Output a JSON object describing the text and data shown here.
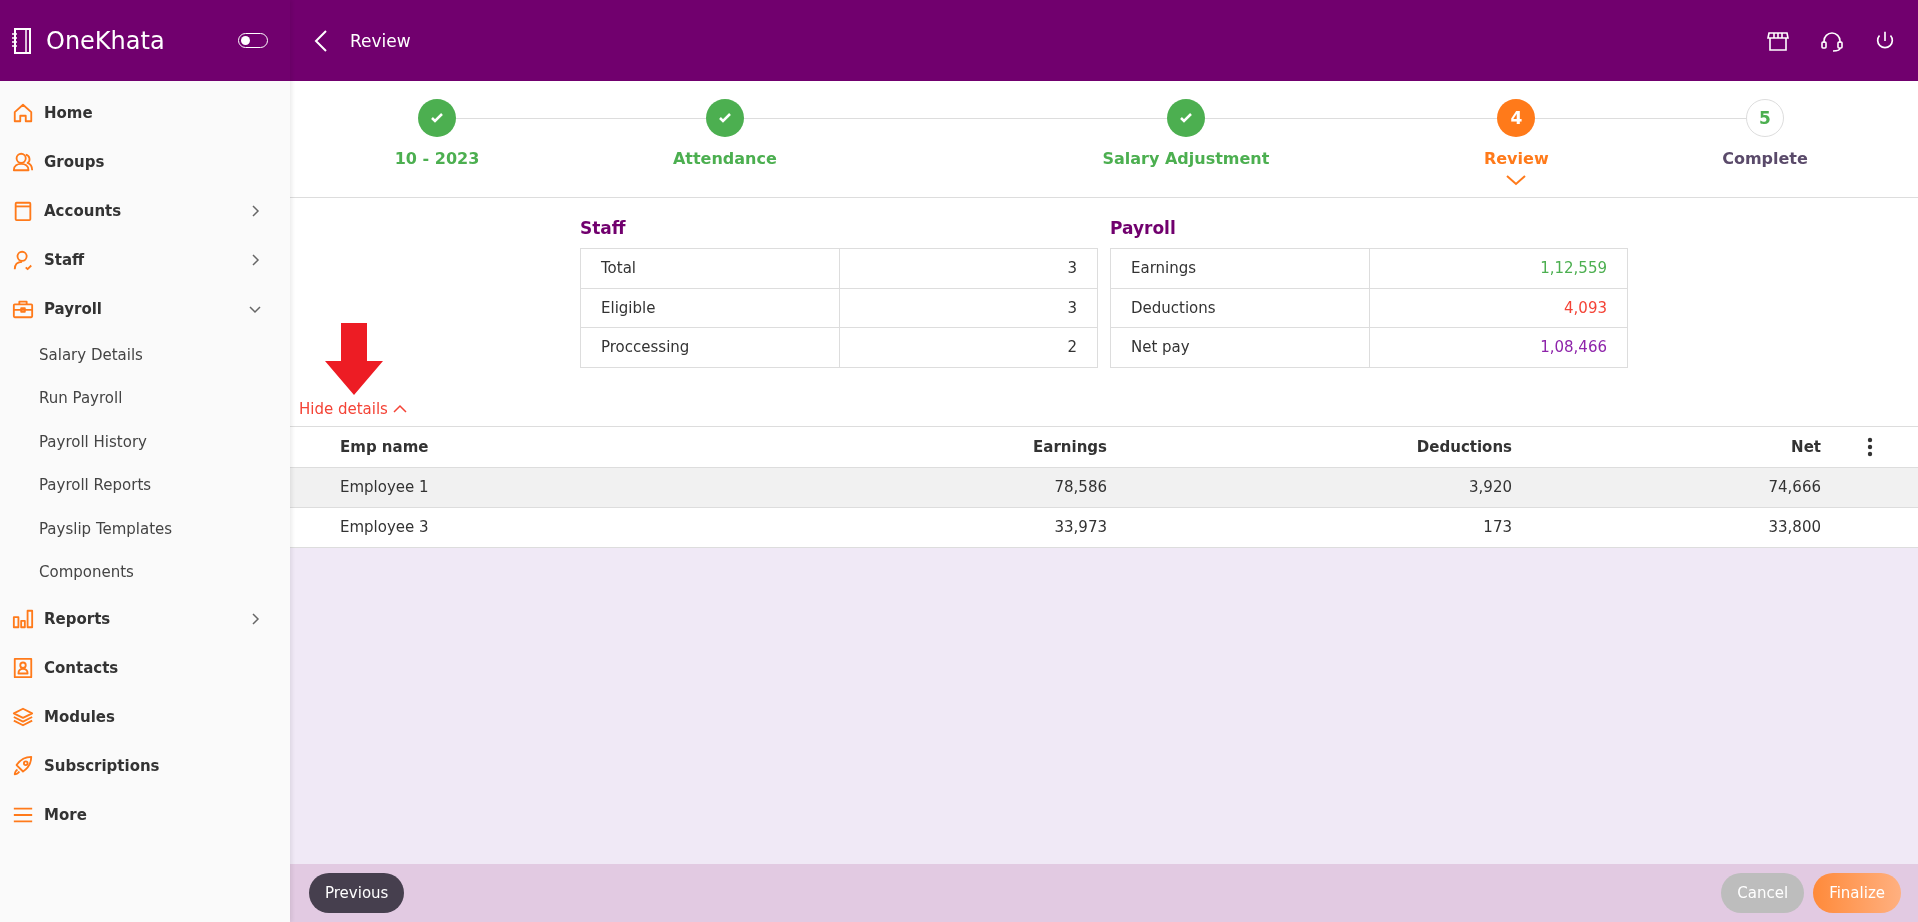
{
  "app": {
    "name": "OneKhata",
    "toggle_on": false
  },
  "sidebar": {
    "items": [
      {
        "label": "Home"
      },
      {
        "label": "Groups"
      },
      {
        "label": "Accounts",
        "expanded": false
      },
      {
        "label": "Staff",
        "expanded": false
      },
      {
        "label": "Payroll",
        "expanded": true,
        "children": [
          {
            "label": "Salary Details"
          },
          {
            "label": "Run Payroll"
          },
          {
            "label": "Payroll History"
          },
          {
            "label": "Payroll Reports"
          },
          {
            "label": "Payslip Templates"
          },
          {
            "label": "Components"
          }
        ]
      },
      {
        "label": "Reports",
        "expanded": false
      },
      {
        "label": "Contacts"
      },
      {
        "label": "Modules"
      },
      {
        "label": "Subscriptions"
      },
      {
        "label": "More"
      }
    ]
  },
  "header": {
    "title": "Review"
  },
  "steps": [
    {
      "label": "10 - 2023",
      "completed": true,
      "selected": false
    },
    {
      "label": "Attendance",
      "completed": true,
      "selected": false
    },
    {
      "label": "Salary Adjustment",
      "completed": true,
      "selected": false
    },
    {
      "label": "Review",
      "number": "4",
      "completed": false,
      "selected": true
    },
    {
      "label": "Complete",
      "number": "5",
      "completed": false,
      "selected": false
    }
  ],
  "summary": [
    {
      "title": "Staff",
      "rows": [
        {
          "label": "Total",
          "value": "3"
        },
        {
          "label": "Eligible",
          "value": "3"
        },
        {
          "label": "Proccessing",
          "value": "2"
        }
      ]
    },
    {
      "title": "Payroll",
      "rows": [
        {
          "label": "Earnings",
          "value": "1,12,559",
          "color": "#4caf50"
        },
        {
          "label": "Deductions",
          "value": "4,093",
          "color": "#f44336"
        },
        {
          "label": "Net pay",
          "value": "1,08,466",
          "color": "#8e24aa"
        }
      ]
    }
  ],
  "details_toggle": {
    "label": "Hide details",
    "expanded": true
  },
  "table": {
    "columns": [
      "Emp name",
      "Earnings",
      "Deductions",
      "Net"
    ],
    "rows": [
      {
        "selected": true,
        "cells": [
          "Employee 1",
          "78,586",
          "3,920",
          "74,666"
        ]
      },
      {
        "selected": false,
        "cells": [
          "Employee 3",
          "33,973",
          "173",
          "33,800"
        ]
      }
    ]
  },
  "footer": {
    "previous": "Previous",
    "cancel": "Cancel",
    "finalize": "Finalize"
  }
}
